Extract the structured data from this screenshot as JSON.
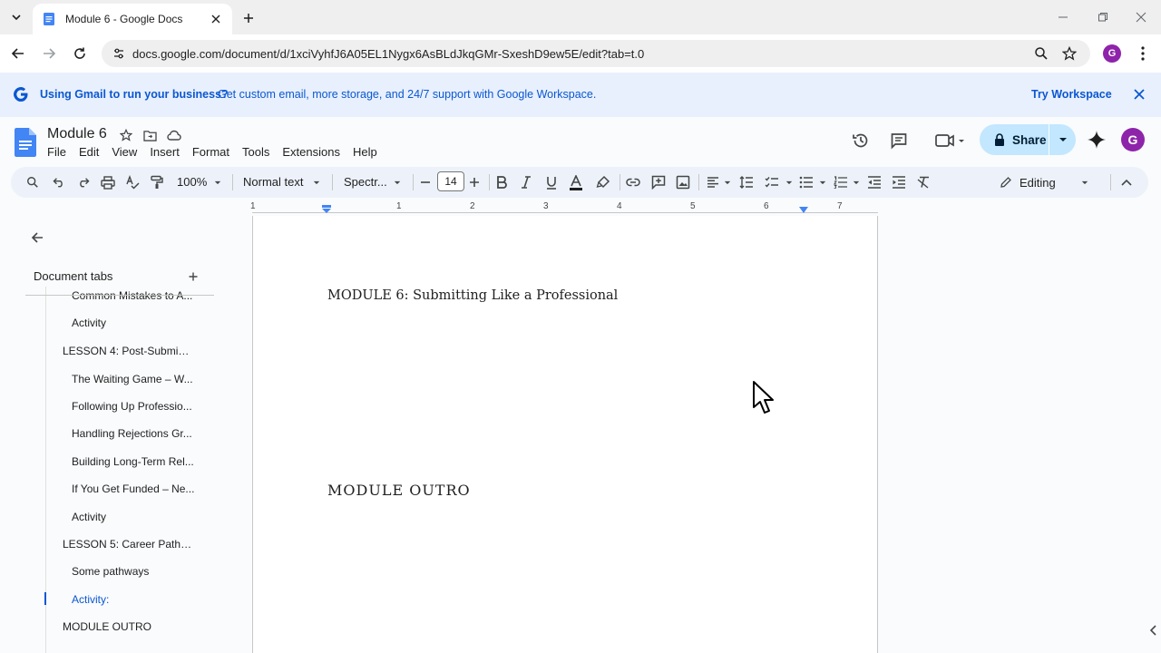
{
  "browser": {
    "tab_title": "Module 6 - Google Docs",
    "url": "docs.google.com/document/d/1xciVyhfJ6A05EL1Nygx6AsBLdJkqGMr-SxeshD9ew5E/edit?tab=t.0",
    "profile_initial": "G"
  },
  "banner": {
    "bold_text": "Using Gmail to run your business?",
    "text": "Get custom email, more storage, and 24/7 support with Google Workspace.",
    "cta": "Try Workspace"
  },
  "doc": {
    "title": "Module 6",
    "menus": [
      "File",
      "Edit",
      "View",
      "Insert",
      "Format",
      "Tools",
      "Extensions",
      "Help"
    ],
    "share_label": "Share",
    "avatar_initial": "G"
  },
  "format": {
    "zoom": "100%",
    "style": "Normal text",
    "font": "Spectr...",
    "font_size": "14",
    "mode": "Editing"
  },
  "ruler": {
    "numbers": [
      "1",
      "1",
      "2",
      "3",
      "4",
      "5",
      "6",
      "7"
    ]
  },
  "sidebar": {
    "header": "Document tabs",
    "items": [
      {
        "label": "Common Mistakes to A...",
        "level": 2
      },
      {
        "label": "Activity",
        "level": 2
      },
      {
        "label": "LESSON 4: Post-Submiss...",
        "level": 1
      },
      {
        "label": "The Waiting Game – W...",
        "level": 2
      },
      {
        "label": "Following Up Professio...",
        "level": 2
      },
      {
        "label": "Handling Rejections Gr...",
        "level": 2
      },
      {
        "label": "Building Long-Term Rel...",
        "level": 2
      },
      {
        "label": "If You Get Funded – Ne...",
        "level": 2
      },
      {
        "label": "Activity",
        "level": 2
      },
      {
        "label": "LESSON 5: Career Pathw...",
        "level": 1
      },
      {
        "label": "Some pathways",
        "level": 2
      },
      {
        "label": "Activity:",
        "level": 2,
        "active": true
      },
      {
        "label": "MODULE OUTRO",
        "level": 1
      }
    ]
  },
  "content": {
    "heading1": "MODULE 6: Submitting Like a Professional",
    "heading2": "MODULE OUTRO"
  },
  "colors": {
    "accent": "#0b57d0",
    "share_bg": "#c2e7ff",
    "banner_bg": "#e8f0fe",
    "avatar": "#8e24aa"
  }
}
